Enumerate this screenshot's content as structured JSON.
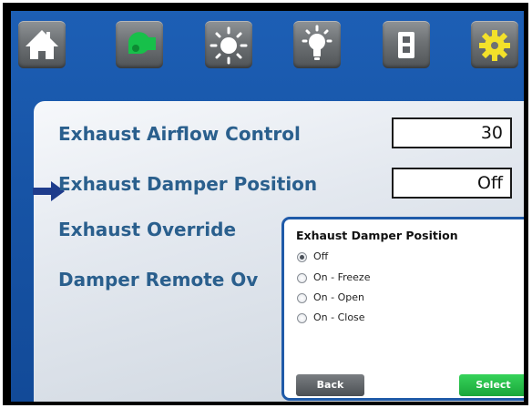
{
  "toolbar": {
    "buttons": [
      {
        "name": "home-button",
        "icon": "home-icon"
      },
      {
        "name": "fan-button",
        "icon": "fan-icon",
        "color": "#17c04a"
      },
      {
        "name": "daylight-button",
        "icon": "sun-icon"
      },
      {
        "name": "lighting-button",
        "icon": "light-bulb-icon"
      },
      {
        "name": "switch-button",
        "icon": "switch-icon"
      },
      {
        "name": "settings-button",
        "icon": "gear-icon",
        "color": "#f3e12a"
      }
    ]
  },
  "main": {
    "rows": [
      {
        "label": "Exhaust Airflow Control",
        "value": "30"
      },
      {
        "label": "Exhaust Damper Position",
        "value": "Off"
      },
      {
        "label": "Exhaust Override"
      },
      {
        "label": "Damper Remote Ov"
      }
    ]
  },
  "dialog": {
    "title": "Exhaust Damper Position",
    "options": [
      "Off",
      "On - Freeze",
      "On - Open",
      "On - Close"
    ],
    "selected": "Off",
    "back_label": "Back",
    "select_label": "Select"
  },
  "colors": {
    "background": "#1754a6",
    "label": "#2a5f8d",
    "select_button": "#1aa63a",
    "dialog_border": "#1f5aa8"
  }
}
